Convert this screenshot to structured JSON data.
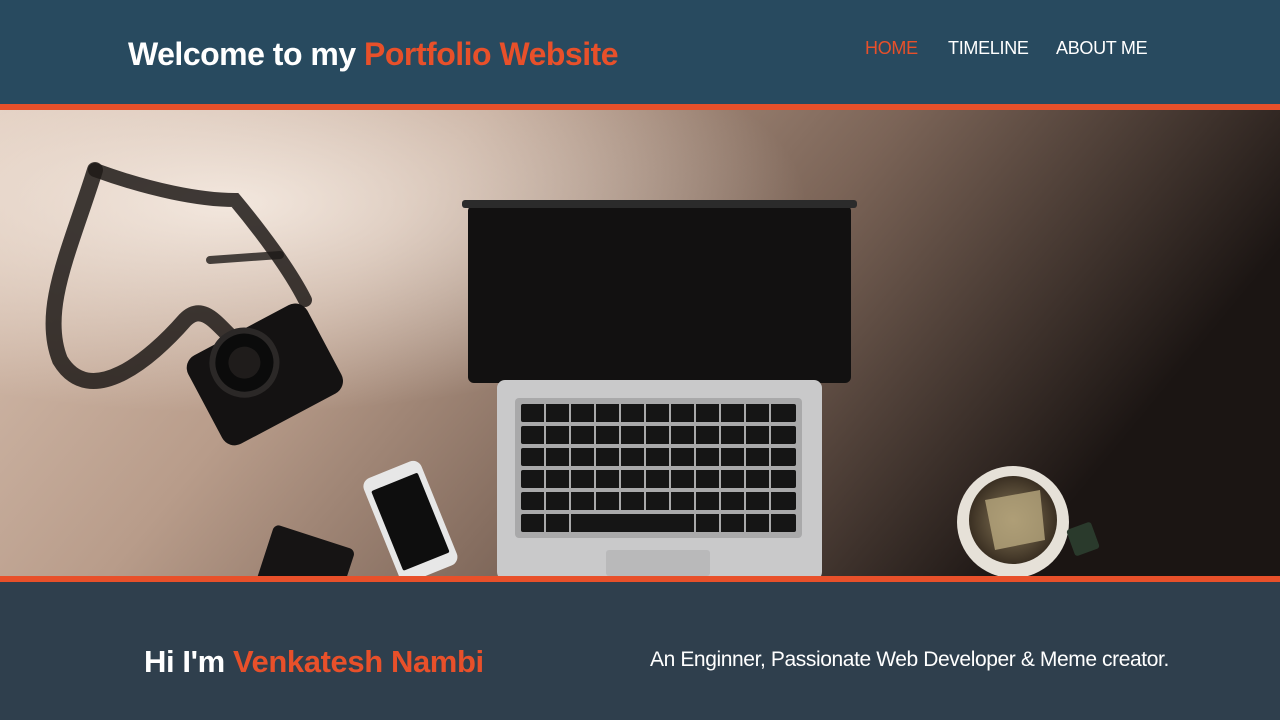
{
  "header": {
    "title_prefix": "Welcome to my",
    "title_accent": "Portfolio Website"
  },
  "nav": {
    "items": [
      {
        "label": "HOME",
        "active": true
      },
      {
        "label": "TIMELINE",
        "active": false
      },
      {
        "label": "ABOUT ME",
        "active": false
      }
    ]
  },
  "hero": {
    "image": "desk-flatlay-laptop-camera-phone-tea"
  },
  "intro": {
    "greeting_prefix": "Hi I'm",
    "name": "Venkatesh Nambi",
    "tagline": "An Enginner, Passionate Web Developer & Meme creator."
  },
  "colors": {
    "header_bg": "#284a5f",
    "accent": "#e8502a",
    "footer_bg": "#2f3f4d",
    "text": "#ffffff"
  }
}
